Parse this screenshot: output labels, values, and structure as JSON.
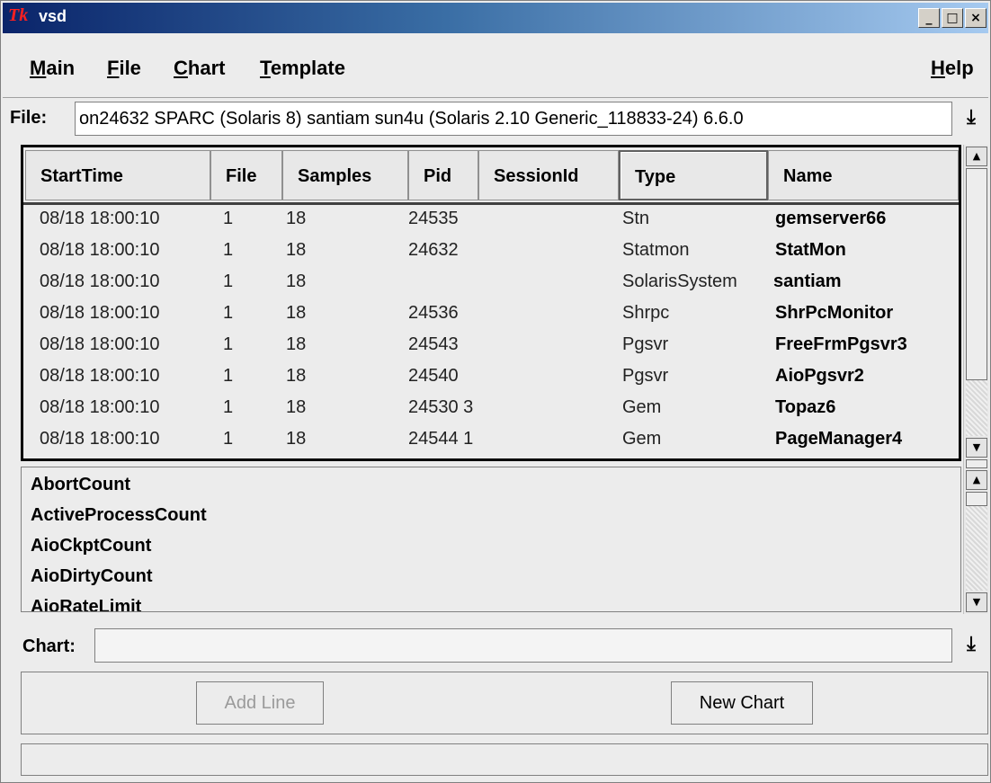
{
  "window": {
    "title": "vsd",
    "logo_text": "Tk",
    "controls": {
      "minimize": "_",
      "maximize": "□",
      "close": "×"
    }
  },
  "menubar": {
    "items": [
      {
        "label_ul": "M",
        "label_rest": "ain"
      },
      {
        "label_ul": "F",
        "label_rest": "ile"
      },
      {
        "label_ul": "C",
        "label_rest": "hart"
      },
      {
        "label_ul": "T",
        "label_rest": "emplate"
      }
    ],
    "help": {
      "label_ul": "H",
      "label_rest": "elp"
    }
  },
  "file": {
    "label": "File:",
    "value": "on24632 SPARC (Solaris 8) santiam sun4u (Solaris 2.10 Generic_118833-24) 6.6.0",
    "dropdown_icon": "⤓"
  },
  "process_table": {
    "columns": [
      "StartTime",
      "File",
      "Samples",
      "Pid",
      "SessionId",
      "Type",
      "Name"
    ],
    "rows": [
      {
        "start": "08/18 18:00:10",
        "file": "1",
        "samples": "18",
        "pid": "24535",
        "session": "",
        "type": "Stn",
        "name": "gemserver66"
      },
      {
        "start": "08/18 18:00:10",
        "file": "1",
        "samples": "18",
        "pid": "24632",
        "session": "",
        "type": "Statmon",
        "name": "StatMon"
      },
      {
        "start": "08/18 18:00:10",
        "file": "1",
        "samples": "18",
        "pid": "",
        "session": "",
        "type": "SolarisSystem",
        "name": "santiam"
      },
      {
        "start": "08/18 18:00:10",
        "file": "1",
        "samples": "18",
        "pid": "24536",
        "session": "",
        "type": "Shrpc",
        "name": "ShrPcMonitor"
      },
      {
        "start": "08/18 18:00:10",
        "file": "1",
        "samples": "18",
        "pid": "24543",
        "session": "",
        "type": "Pgsvr",
        "name": "FreeFrmPgsvr3"
      },
      {
        "start": "08/18 18:00:10",
        "file": "1",
        "samples": "18",
        "pid": "24540",
        "session": "",
        "type": "Pgsvr",
        "name": "AioPgsvr2"
      },
      {
        "start": "08/18 18:00:10",
        "file": "1",
        "samples": "18",
        "pid": "24530 3",
        "session": "",
        "type": "Gem",
        "name": "Topaz6"
      },
      {
        "start": "08/18 18:00:10",
        "file": "1",
        "samples": "18",
        "pid": "24544 1",
        "session": "",
        "type": "Gem",
        "name": "PageManager4"
      }
    ]
  },
  "stat_list": {
    "items": [
      "AbortCount",
      "ActiveProcessCount",
      "AioCkptCount",
      "AioDirtyCount",
      "AioRateLimit"
    ]
  },
  "chart": {
    "label": "Chart:",
    "value": "",
    "dropdown_icon": "⤓"
  },
  "buttons": {
    "add_line": "Add Line",
    "new_chart": "New Chart"
  },
  "status": {
    "text": ""
  }
}
